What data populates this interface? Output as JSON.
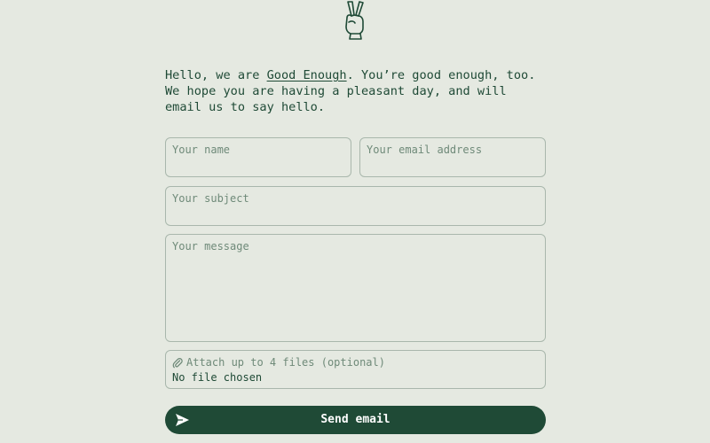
{
  "intro": {
    "before_link": "Hello, we are ",
    "link_text": "Good Enough",
    "after_link": ". You’re good enough, too. We hope you are having a pleasant day, and will email us to say hello."
  },
  "form": {
    "name_placeholder": "Your name",
    "email_placeholder": "Your email address",
    "subject_placeholder": "Your subject",
    "message_placeholder": "Your message",
    "attach_label": "Attach up to 4 files (optional)",
    "attach_status": "No file chosen",
    "send_label": "Send email"
  },
  "icons": {
    "logo": "peace-hand-icon",
    "attach": "paperclip-icon",
    "send": "paper-plane-icon"
  },
  "colors": {
    "background": "#e5e9e1",
    "accent": "#1f4a36",
    "border": "#a9b7ac",
    "placeholder": "#6f8a79"
  }
}
